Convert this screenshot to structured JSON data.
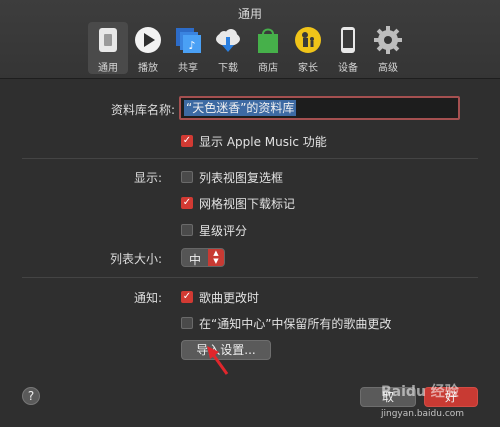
{
  "window": {
    "title": "通用"
  },
  "toolbar": {
    "items": [
      {
        "label": "通用",
        "icon": "general-switch-icon",
        "active": true
      },
      {
        "label": "播放",
        "icon": "play-icon"
      },
      {
        "label": "共享",
        "icon": "sharing-music-icon"
      },
      {
        "label": "下载",
        "icon": "download-cloud-icon"
      },
      {
        "label": "商店",
        "icon": "store-bag-icon"
      },
      {
        "label": "家长",
        "icon": "parental-icon"
      },
      {
        "label": "设备",
        "icon": "device-phone-icon"
      },
      {
        "label": "高级",
        "icon": "gear-icon"
      }
    ]
  },
  "library": {
    "label": "资料库名称:",
    "name_value": "“天色迷香”的资料库",
    "apple_music_label": "显示 Apple Music 功能",
    "apple_music_checked": true
  },
  "display": {
    "label": "显示:",
    "options": [
      {
        "label": "列表视图复选框",
        "checked": false
      },
      {
        "label": "网格视图下载标记",
        "checked": true
      },
      {
        "label": "星级评分",
        "checked": false
      }
    ],
    "list_size_label": "列表大小:",
    "list_size_value": "中"
  },
  "notifications": {
    "label": "通知:",
    "options": [
      {
        "label": "歌曲更改时",
        "checked": true
      },
      {
        "label": "在“通知中心”中保留所有的歌曲更改",
        "checked": false
      }
    ],
    "import_button": "导入设置..."
  },
  "footer": {
    "help": "?",
    "cancel_button": "取",
    "ok_button": "好"
  },
  "watermark": {
    "logo_text": "Baidu 经验",
    "url": "jingyan.baidu.com"
  },
  "colors": {
    "accent": "#d23a33",
    "selection": "#3d6aa3",
    "field_border": "#a55050"
  }
}
